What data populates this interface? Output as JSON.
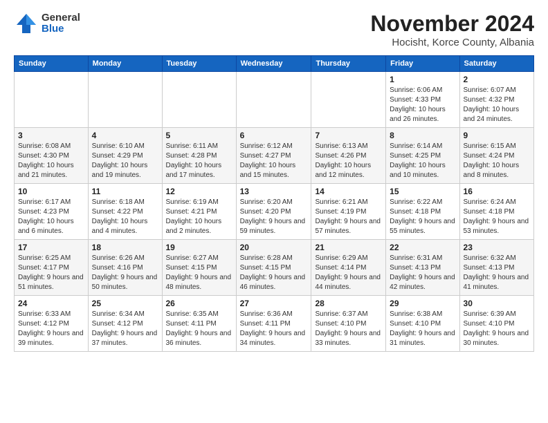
{
  "logo": {
    "general": "General",
    "blue": "Blue"
  },
  "title": {
    "month": "November 2024",
    "location": "Hocisht, Korce County, Albania"
  },
  "weekdays": [
    "Sunday",
    "Monday",
    "Tuesday",
    "Wednesday",
    "Thursday",
    "Friday",
    "Saturday"
  ],
  "weeks": [
    [
      {
        "day": "",
        "info": ""
      },
      {
        "day": "",
        "info": ""
      },
      {
        "day": "",
        "info": ""
      },
      {
        "day": "",
        "info": ""
      },
      {
        "day": "",
        "info": ""
      },
      {
        "day": "1",
        "info": "Sunrise: 6:06 AM\nSunset: 4:33 PM\nDaylight: 10 hours and 26 minutes."
      },
      {
        "day": "2",
        "info": "Sunrise: 6:07 AM\nSunset: 4:32 PM\nDaylight: 10 hours and 24 minutes."
      }
    ],
    [
      {
        "day": "3",
        "info": "Sunrise: 6:08 AM\nSunset: 4:30 PM\nDaylight: 10 hours and 21 minutes."
      },
      {
        "day": "4",
        "info": "Sunrise: 6:10 AM\nSunset: 4:29 PM\nDaylight: 10 hours and 19 minutes."
      },
      {
        "day": "5",
        "info": "Sunrise: 6:11 AM\nSunset: 4:28 PM\nDaylight: 10 hours and 17 minutes."
      },
      {
        "day": "6",
        "info": "Sunrise: 6:12 AM\nSunset: 4:27 PM\nDaylight: 10 hours and 15 minutes."
      },
      {
        "day": "7",
        "info": "Sunrise: 6:13 AM\nSunset: 4:26 PM\nDaylight: 10 hours and 12 minutes."
      },
      {
        "day": "8",
        "info": "Sunrise: 6:14 AM\nSunset: 4:25 PM\nDaylight: 10 hours and 10 minutes."
      },
      {
        "day": "9",
        "info": "Sunrise: 6:15 AM\nSunset: 4:24 PM\nDaylight: 10 hours and 8 minutes."
      }
    ],
    [
      {
        "day": "10",
        "info": "Sunrise: 6:17 AM\nSunset: 4:23 PM\nDaylight: 10 hours and 6 minutes."
      },
      {
        "day": "11",
        "info": "Sunrise: 6:18 AM\nSunset: 4:22 PM\nDaylight: 10 hours and 4 minutes."
      },
      {
        "day": "12",
        "info": "Sunrise: 6:19 AM\nSunset: 4:21 PM\nDaylight: 10 hours and 2 minutes."
      },
      {
        "day": "13",
        "info": "Sunrise: 6:20 AM\nSunset: 4:20 PM\nDaylight: 9 hours and 59 minutes."
      },
      {
        "day": "14",
        "info": "Sunrise: 6:21 AM\nSunset: 4:19 PM\nDaylight: 9 hours and 57 minutes."
      },
      {
        "day": "15",
        "info": "Sunrise: 6:22 AM\nSunset: 4:18 PM\nDaylight: 9 hours and 55 minutes."
      },
      {
        "day": "16",
        "info": "Sunrise: 6:24 AM\nSunset: 4:18 PM\nDaylight: 9 hours and 53 minutes."
      }
    ],
    [
      {
        "day": "17",
        "info": "Sunrise: 6:25 AM\nSunset: 4:17 PM\nDaylight: 9 hours and 51 minutes."
      },
      {
        "day": "18",
        "info": "Sunrise: 6:26 AM\nSunset: 4:16 PM\nDaylight: 9 hours and 50 minutes."
      },
      {
        "day": "19",
        "info": "Sunrise: 6:27 AM\nSunset: 4:15 PM\nDaylight: 9 hours and 48 minutes."
      },
      {
        "day": "20",
        "info": "Sunrise: 6:28 AM\nSunset: 4:15 PM\nDaylight: 9 hours and 46 minutes."
      },
      {
        "day": "21",
        "info": "Sunrise: 6:29 AM\nSunset: 4:14 PM\nDaylight: 9 hours and 44 minutes."
      },
      {
        "day": "22",
        "info": "Sunrise: 6:31 AM\nSunset: 4:13 PM\nDaylight: 9 hours and 42 minutes."
      },
      {
        "day": "23",
        "info": "Sunrise: 6:32 AM\nSunset: 4:13 PM\nDaylight: 9 hours and 41 minutes."
      }
    ],
    [
      {
        "day": "24",
        "info": "Sunrise: 6:33 AM\nSunset: 4:12 PM\nDaylight: 9 hours and 39 minutes."
      },
      {
        "day": "25",
        "info": "Sunrise: 6:34 AM\nSunset: 4:12 PM\nDaylight: 9 hours and 37 minutes."
      },
      {
        "day": "26",
        "info": "Sunrise: 6:35 AM\nSunset: 4:11 PM\nDaylight: 9 hours and 36 minutes."
      },
      {
        "day": "27",
        "info": "Sunrise: 6:36 AM\nSunset: 4:11 PM\nDaylight: 9 hours and 34 minutes."
      },
      {
        "day": "28",
        "info": "Sunrise: 6:37 AM\nSunset: 4:10 PM\nDaylight: 9 hours and 33 minutes."
      },
      {
        "day": "29",
        "info": "Sunrise: 6:38 AM\nSunset: 4:10 PM\nDaylight: 9 hours and 31 minutes."
      },
      {
        "day": "30",
        "info": "Sunrise: 6:39 AM\nSunset: 4:10 PM\nDaylight: 9 hours and 30 minutes."
      }
    ]
  ]
}
